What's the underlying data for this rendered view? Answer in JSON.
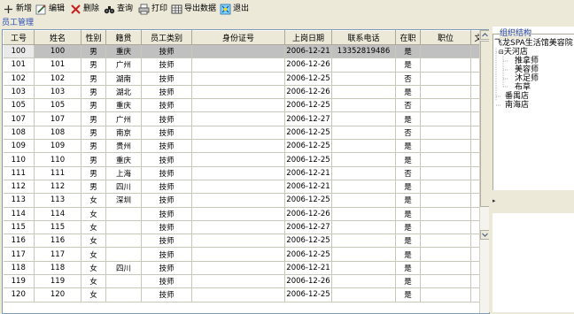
{
  "toolbar": {
    "buttons": [
      {
        "name": "add-button",
        "icon": "plus-icon",
        "label": "新增"
      },
      {
        "name": "edit-button",
        "icon": "edit-icon",
        "label": "编辑"
      },
      {
        "name": "delete-button",
        "icon": "close-icon",
        "label": "删除"
      },
      {
        "name": "query-button",
        "icon": "binoculars-icon",
        "label": "查询"
      },
      {
        "name": "print-button",
        "icon": "printer-icon",
        "label": "打印"
      },
      {
        "name": "export-button",
        "icon": "table-icon",
        "label": "导出数据"
      },
      {
        "name": "exit-button",
        "icon": "exit-icon",
        "label": "退出"
      }
    ]
  },
  "staff_panel": {
    "title": "员工管理"
  },
  "grid": {
    "columns": [
      "工号",
      "姓名",
      "性别",
      "籍贯",
      "员工类别",
      "身份证号",
      "上岗日期",
      "联系电话",
      "在职",
      "职位",
      "文"
    ],
    "rows": [
      [
        "100",
        "100",
        "男",
        "重庆",
        "技师",
        "",
        "2006-12-21",
        "13352819486",
        "是",
        "",
        ""
      ],
      [
        "101",
        "101",
        "男",
        "广州",
        "技师",
        "",
        "2006-12-26",
        "",
        "是",
        "",
        ""
      ],
      [
        "102",
        "102",
        "男",
        "湖南",
        "技师",
        "",
        "2006-12-25",
        "",
        "否",
        "",
        ""
      ],
      [
        "103",
        "103",
        "男",
        "湖北",
        "技师",
        "",
        "2006-12-26",
        "",
        "是",
        "",
        ""
      ],
      [
        "105",
        "105",
        "男",
        "重庆",
        "技师",
        "",
        "2006-12-25",
        "",
        "否",
        "",
        ""
      ],
      [
        "107",
        "107",
        "男",
        "广州",
        "技师",
        "",
        "2006-12-27",
        "",
        "是",
        "",
        ""
      ],
      [
        "108",
        "108",
        "男",
        "南京",
        "技师",
        "",
        "2006-12-25",
        "",
        "否",
        "",
        ""
      ],
      [
        "109",
        "109",
        "男",
        "贵州",
        "技师",
        "",
        "2006-12-25",
        "",
        "是",
        "",
        ""
      ],
      [
        "110",
        "110",
        "男",
        "重庆",
        "技师",
        "",
        "2006-12-25",
        "",
        "是",
        "",
        ""
      ],
      [
        "111",
        "111",
        "男",
        "上海",
        "技师",
        "",
        "2006-12-21",
        "",
        "否",
        "",
        ""
      ],
      [
        "112",
        "112",
        "男",
        "四川",
        "技师",
        "",
        "2006-12-21",
        "",
        "是",
        "",
        ""
      ],
      [
        "113",
        "113",
        "女",
        "深圳",
        "技师",
        "",
        "2006-12-25",
        "",
        "是",
        "",
        ""
      ],
      [
        "114",
        "114",
        "女",
        "",
        "技师",
        "",
        "2006-12-26",
        "",
        "是",
        "",
        ""
      ],
      [
        "115",
        "115",
        "女",
        "",
        "技师",
        "",
        "2006-12-27",
        "",
        "是",
        "",
        ""
      ],
      [
        "116",
        "116",
        "女",
        "",
        "技师",
        "",
        "2006-12-25",
        "",
        "是",
        "",
        ""
      ],
      [
        "117",
        "117",
        "女",
        "",
        "技师",
        "",
        "2006-12-25",
        "",
        "是",
        "",
        ""
      ],
      [
        "118",
        "118",
        "女",
        "四川",
        "技师",
        "",
        "2006-12-21",
        "",
        "是",
        "",
        ""
      ],
      [
        "119",
        "119",
        "女",
        "",
        "技师",
        "",
        "2006-12-26",
        "",
        "是",
        "",
        ""
      ],
      [
        "120",
        "120",
        "女",
        "",
        "技师",
        "",
        "2006-12-25",
        "",
        "是",
        "",
        ""
      ]
    ],
    "selected_row": 0
  },
  "org_panel": {
    "title": "组织结构",
    "nodes": [
      {
        "label": "飞龙SPA生活馆美容院",
        "level": 0
      },
      {
        "label": "天河店",
        "level": 1,
        "expander": "⊟"
      },
      {
        "label": "推拿师",
        "level": 2
      },
      {
        "label": "美容师",
        "level": 2
      },
      {
        "label": "沐足师",
        "level": 2
      },
      {
        "label": "布草",
        "level": 2
      },
      {
        "label": "番禺店",
        "level": 1
      },
      {
        "label": "南海店",
        "level": 1
      }
    ]
  },
  "colors": {
    "accent": "#2a4db7",
    "selected_row": "#c0c0c0",
    "chrome": "#ece9d8"
  }
}
